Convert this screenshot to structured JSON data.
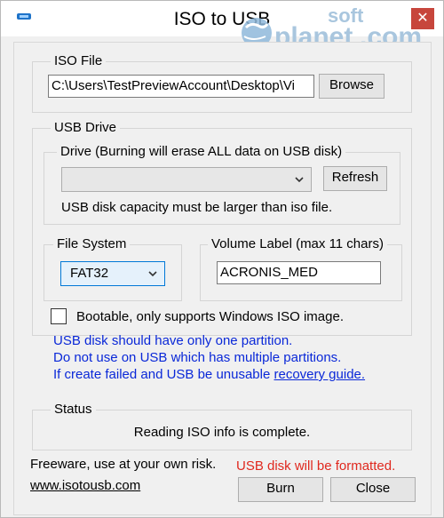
{
  "window": {
    "title": "ISO to USB",
    "close_glyph": "✕"
  },
  "watermark": {
    "text1": "soft",
    "text2": "planet",
    "text3": ".com"
  },
  "iso_file": {
    "legend": "ISO File",
    "path_value": "C:\\Users\\TestPreviewAccount\\Desktop\\Vi",
    "browse_label": "Browse"
  },
  "usb_drive": {
    "legend": "USB Drive",
    "drive_legend": "Drive (Burning will erase ALL data on USB disk)",
    "drive_value": "",
    "refresh_label": "Refresh",
    "capacity_note": "USB disk capacity must be larger than iso file.",
    "file_system_legend": "File System",
    "file_system_value": "FAT32",
    "volume_legend": "Volume Label (max 11 chars)",
    "volume_value": "ACRONIS_MED"
  },
  "options": {
    "bootable_label": "Bootable, only supports Windows ISO image.",
    "bootable_checked": false
  },
  "notes": {
    "line1": "USB disk should have only one partition.",
    "line2": "Do not use on USB which has multiple partitions.",
    "line3_prefix": "If create failed and USB be unusable ",
    "line3_link": "recovery guide."
  },
  "status": {
    "legend": "Status",
    "message": "Reading ISO info is complete."
  },
  "footer": {
    "freeware_note": "Freeware, use at your own risk.",
    "website_link": "www.isotousb.com",
    "format_warning": "USB disk will be formatted.",
    "burn_label": "Burn",
    "close_label": "Close"
  },
  "colors": {
    "note_blue": "#0a28d8",
    "warning_red": "#e0281e",
    "close_red": "#c7463c"
  }
}
